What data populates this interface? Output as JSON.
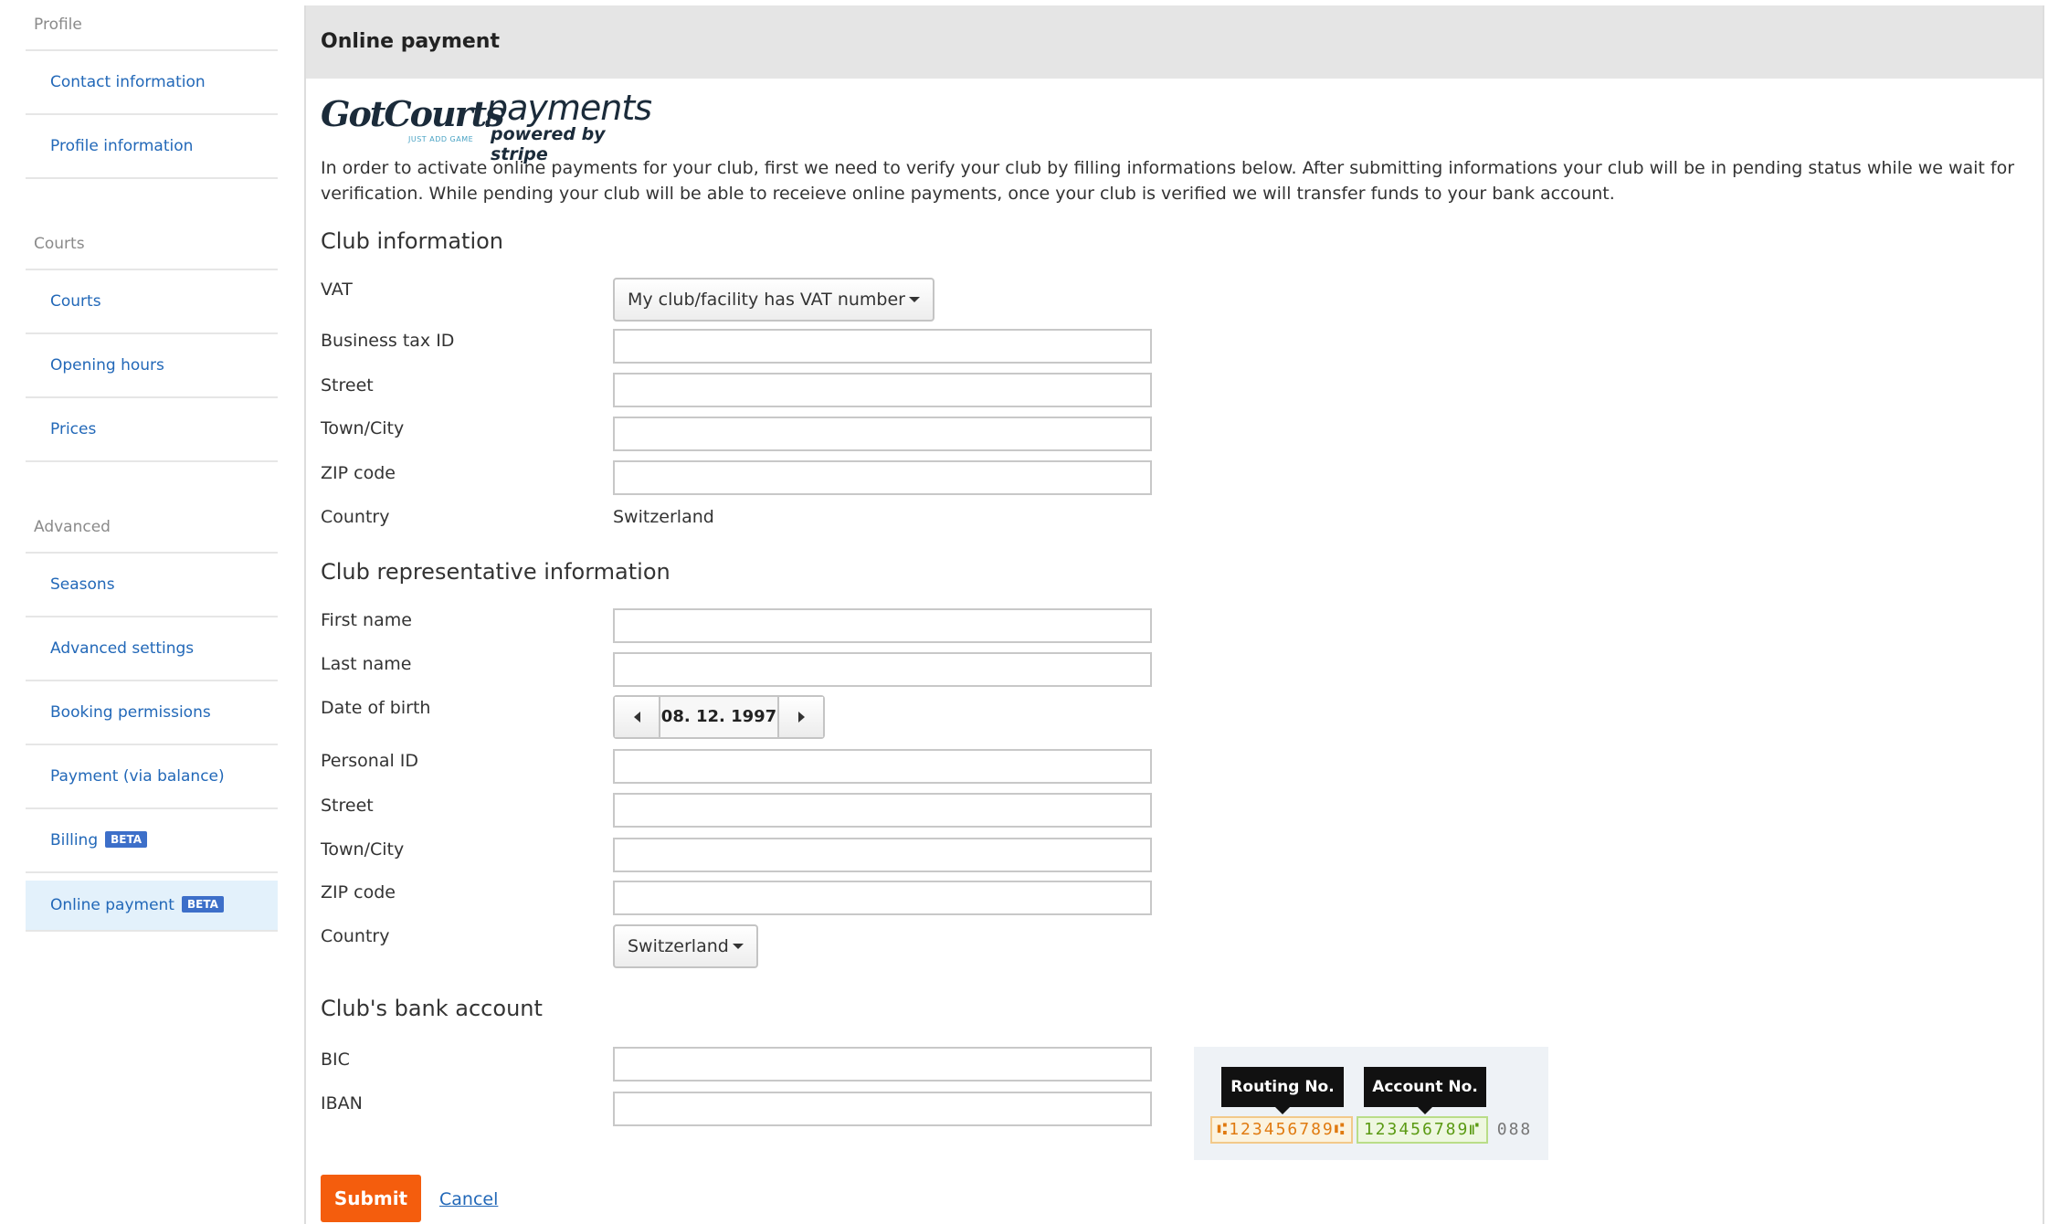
{
  "sidebar": {
    "sections": [
      {
        "title": "Profile",
        "items": [
          {
            "label": "Contact information"
          },
          {
            "label": "Profile information"
          }
        ]
      },
      {
        "title": "Courts",
        "items": [
          {
            "label": "Courts"
          },
          {
            "label": "Opening hours"
          },
          {
            "label": "Prices"
          }
        ]
      },
      {
        "title": "Advanced",
        "items": [
          {
            "label": "Seasons"
          },
          {
            "label": "Advanced settings"
          },
          {
            "label": "Booking permissions"
          },
          {
            "label": "Payment (via balance)"
          },
          {
            "label": "Billing",
            "badge": "BETA"
          },
          {
            "label": "Online payment",
            "badge": "BETA",
            "active": true
          }
        ]
      }
    ]
  },
  "panel": {
    "title": "Online payment",
    "logo": {
      "brand": "GotCourts",
      "tagline": "JUST ADD GAME",
      "product": "payments",
      "powered": "powered by stripe"
    },
    "intro": "In order to activate online payments for your club, first we need to verify your club by filling informations below. After submitting informations your club will be in pending status while we wait for verification. While pending your club will be able to receieve online payments, once your club is verified we will transfer funds to your bank account."
  },
  "club": {
    "heading": "Club information",
    "vat_label": "VAT",
    "vat_value": "My club/facility has VAT number",
    "tax_label": "Business tax ID",
    "street_label": "Street",
    "town_label": "Town/City",
    "zip_label": "ZIP code",
    "country_label": "Country",
    "country_value": "Switzerland"
  },
  "rep": {
    "heading": "Club representative information",
    "first_label": "First name",
    "last_label": "Last name",
    "dob_label": "Date of birth",
    "dob_value": "08. 12. 1997",
    "pid_label": "Personal ID",
    "street_label": "Street",
    "town_label": "Town/City",
    "zip_label": "ZIP code",
    "country_label": "Country",
    "country_value": "Switzerland"
  },
  "bank": {
    "heading": "Club's bank account",
    "bic_label": "BIC",
    "iban_label": "IBAN",
    "routing_label": "Routing No.",
    "account_label": "Account No.",
    "routing_digits": "⑆123456789⑆",
    "account_digits": "123456789⑈",
    "check_digits": "088"
  },
  "actions": {
    "submit": "Submit",
    "cancel": "Cancel"
  },
  "colors": {
    "accent": "#f45d0d",
    "link": "#2268b8",
    "beta": "#3d6fc9",
    "active_bg": "#e3f1fb"
  }
}
